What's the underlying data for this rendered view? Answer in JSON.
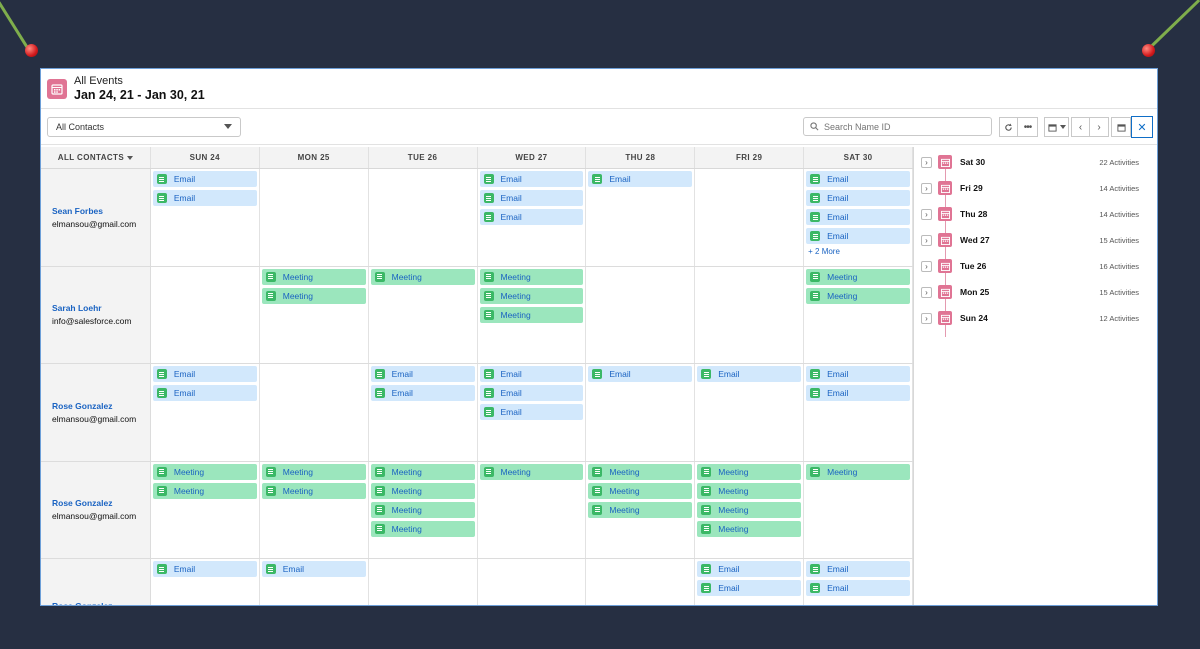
{
  "colors": {
    "background": "#262f42",
    "accent": "#e07494",
    "link": "#1a63c2",
    "email_bg": "#d2e8fc",
    "meeting_bg": "#9be6bd",
    "icon_green": "#3bb866"
  },
  "header": {
    "subtitle": "All Events",
    "title": "Jan 24, 21 - Jan 30, 21",
    "icon": "calendar-icon"
  },
  "toolbar": {
    "filter_value": "All Contacts",
    "search_placeholder": "Search Name ID",
    "icons": [
      "refresh-icon",
      "more-icon",
      "calendar-view-icon",
      "chevron-left-icon",
      "chevron-right-icon",
      "calendar-icon",
      "close-icon"
    ]
  },
  "grid": {
    "contacts_header": "ALL CONTACTS",
    "days": [
      "SUN 24",
      "MON 25",
      "TUE 26",
      "WED 27",
      "THU 28",
      "FRI 29",
      "SAT 30"
    ],
    "rows": [
      {
        "name": "Sean Forbes",
        "email": "elmansou@gmail.com",
        "cells": [
          {
            "events": [
              "Email",
              "Email"
            ]
          },
          {
            "events": []
          },
          {
            "events": []
          },
          {
            "events": [
              "Email",
              "Email",
              "Email"
            ]
          },
          {
            "events": [
              "Email"
            ]
          },
          {
            "events": []
          },
          {
            "events": [
              "Email",
              "Email",
              "Email",
              "Email"
            ],
            "more": "+ 2 More"
          }
        ]
      },
      {
        "name": "Sarah Loehr",
        "email": "info@salesforce.com",
        "cells": [
          {
            "events": []
          },
          {
            "events": [
              "Meeting",
              "Meeting"
            ]
          },
          {
            "events": [
              "Meeting"
            ]
          },
          {
            "events": [
              "Meeting",
              "Meeting",
              "Meeting"
            ]
          },
          {
            "events": []
          },
          {
            "events": []
          },
          {
            "events": [
              "Meeting",
              "Meeting"
            ]
          }
        ]
      },
      {
        "name": "Rose Gonzalez",
        "email": "elmansou@gmail.com",
        "cells": [
          {
            "events": [
              "Email",
              "Email"
            ]
          },
          {
            "events": []
          },
          {
            "events": [
              "Email",
              "Email"
            ]
          },
          {
            "events": [
              "Email",
              "Email",
              "Email"
            ]
          },
          {
            "events": [
              "Email"
            ]
          },
          {
            "events": [
              "Email"
            ]
          },
          {
            "events": [
              "Email",
              "Email"
            ]
          }
        ]
      },
      {
        "name": "Rose Gonzalez",
        "email": "elmansou@gmail.com",
        "cells": [
          {
            "events": [
              "Meeting",
              "Meeting"
            ]
          },
          {
            "events": [
              "Meeting",
              "Meeting"
            ]
          },
          {
            "events": [
              "Meeting",
              "Meeting",
              "Meeting",
              "Meeting"
            ]
          },
          {
            "events": [
              "Meeting"
            ]
          },
          {
            "events": [
              "Meeting",
              "Meeting",
              "Meeting"
            ]
          },
          {
            "events": [
              "Meeting",
              "Meeting",
              "Meeting",
              "Meeting"
            ]
          },
          {
            "events": [
              "Meeting"
            ]
          }
        ]
      },
      {
        "name": "Rose Gonzalez",
        "email": "",
        "cells": [
          {
            "events": [
              "Email"
            ]
          },
          {
            "events": [
              "Email"
            ]
          },
          {
            "events": []
          },
          {
            "events": []
          },
          {
            "events": []
          },
          {
            "events": [
              "Email",
              "Email"
            ]
          },
          {
            "events": [
              "Email",
              "Email"
            ]
          }
        ]
      }
    ]
  },
  "sidebar": {
    "items": [
      {
        "day": "Sat 30",
        "count": "22 Activities"
      },
      {
        "day": "Fri 29",
        "count": "14 Activities"
      },
      {
        "day": "Thu 28",
        "count": "14 Activities"
      },
      {
        "day": "Wed 27",
        "count": "15 Activities"
      },
      {
        "day": "Tue 26",
        "count": "16 Activities"
      },
      {
        "day": "Mon 25",
        "count": "15 Activities"
      },
      {
        "day": "Sun 24",
        "count": "12 Activities"
      }
    ]
  }
}
